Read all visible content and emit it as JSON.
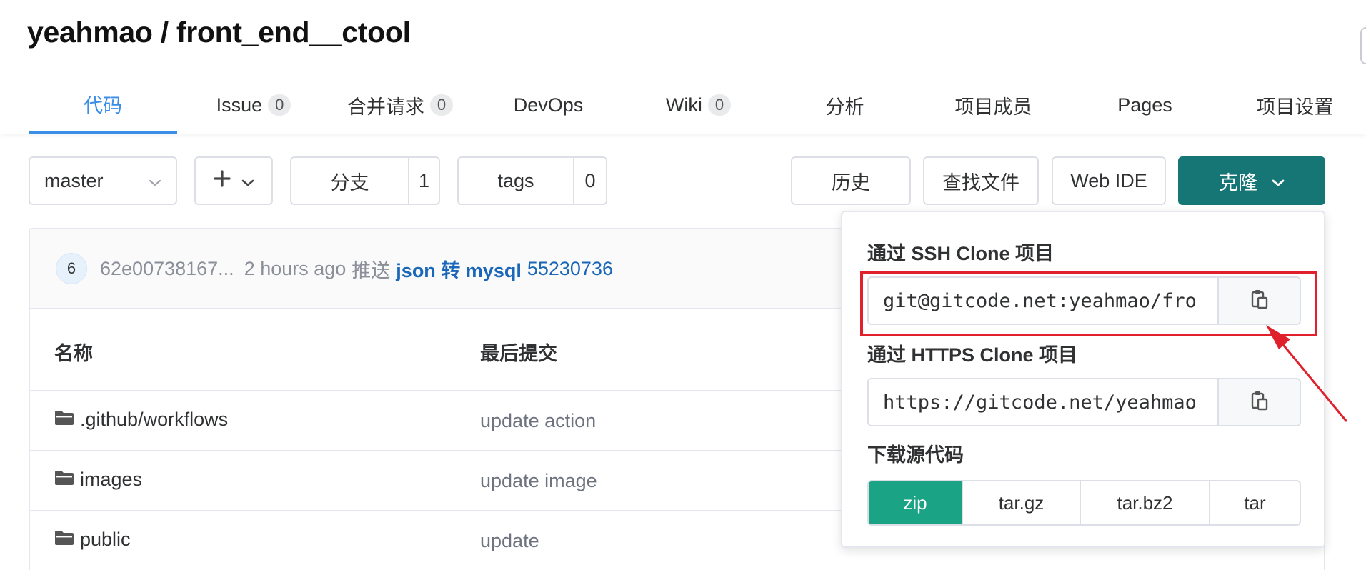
{
  "project": {
    "title": "yeahmao / front_end__ctool"
  },
  "nav": {
    "tabs": [
      {
        "label": "代码",
        "active": true
      },
      {
        "label": "Issue",
        "count": "0"
      },
      {
        "label": "合并请求",
        "count": "0"
      },
      {
        "label": "DevOps"
      },
      {
        "label": "Wiki",
        "count": "0"
      },
      {
        "label": "分析"
      },
      {
        "label": "项目成员"
      },
      {
        "label": "Pages"
      },
      {
        "label": "项目设置"
      }
    ]
  },
  "toolbar": {
    "branch_select": "master",
    "add_icon": "plus-icon",
    "branches_label": "分支",
    "branches_count": "1",
    "tags_label": "tags",
    "tags_count": "0",
    "history": "历史",
    "find_file": "查找文件",
    "web_ide": "Web IDE",
    "clone": "克隆"
  },
  "commit": {
    "avatar": "6",
    "sha_short": "62e00738167...",
    "time": "2 hours ago",
    "action": "推送",
    "message": "json 转 mysql",
    "commit_id": "55230736"
  },
  "table": {
    "headers": {
      "name": "名称",
      "last_commit": "最后提交"
    },
    "rows": [
      {
        "name": ".github/workflows",
        "message": "update action"
      },
      {
        "name": "images",
        "message": "update image"
      },
      {
        "name": "public",
        "message": "update"
      }
    ]
  },
  "clone_dropdown": {
    "ssh_label": "通过 SSH Clone 项目",
    "ssh_url": "git@gitcode.net:yeahmao/fro",
    "https_label": "通过 HTTPS Clone 项目",
    "https_url": "https://gitcode.net/yeahmao",
    "download_label": "下载源代码",
    "formats": [
      {
        "label": "zip",
        "active": true
      },
      {
        "label": "tar.gz"
      },
      {
        "label": "tar.bz2"
      },
      {
        "label": "tar"
      }
    ]
  },
  "colors": {
    "accent": "#3a8ee6",
    "clone_button": "#167575",
    "zip_active": "#1aa385",
    "annotation_red": "#e0202b"
  }
}
